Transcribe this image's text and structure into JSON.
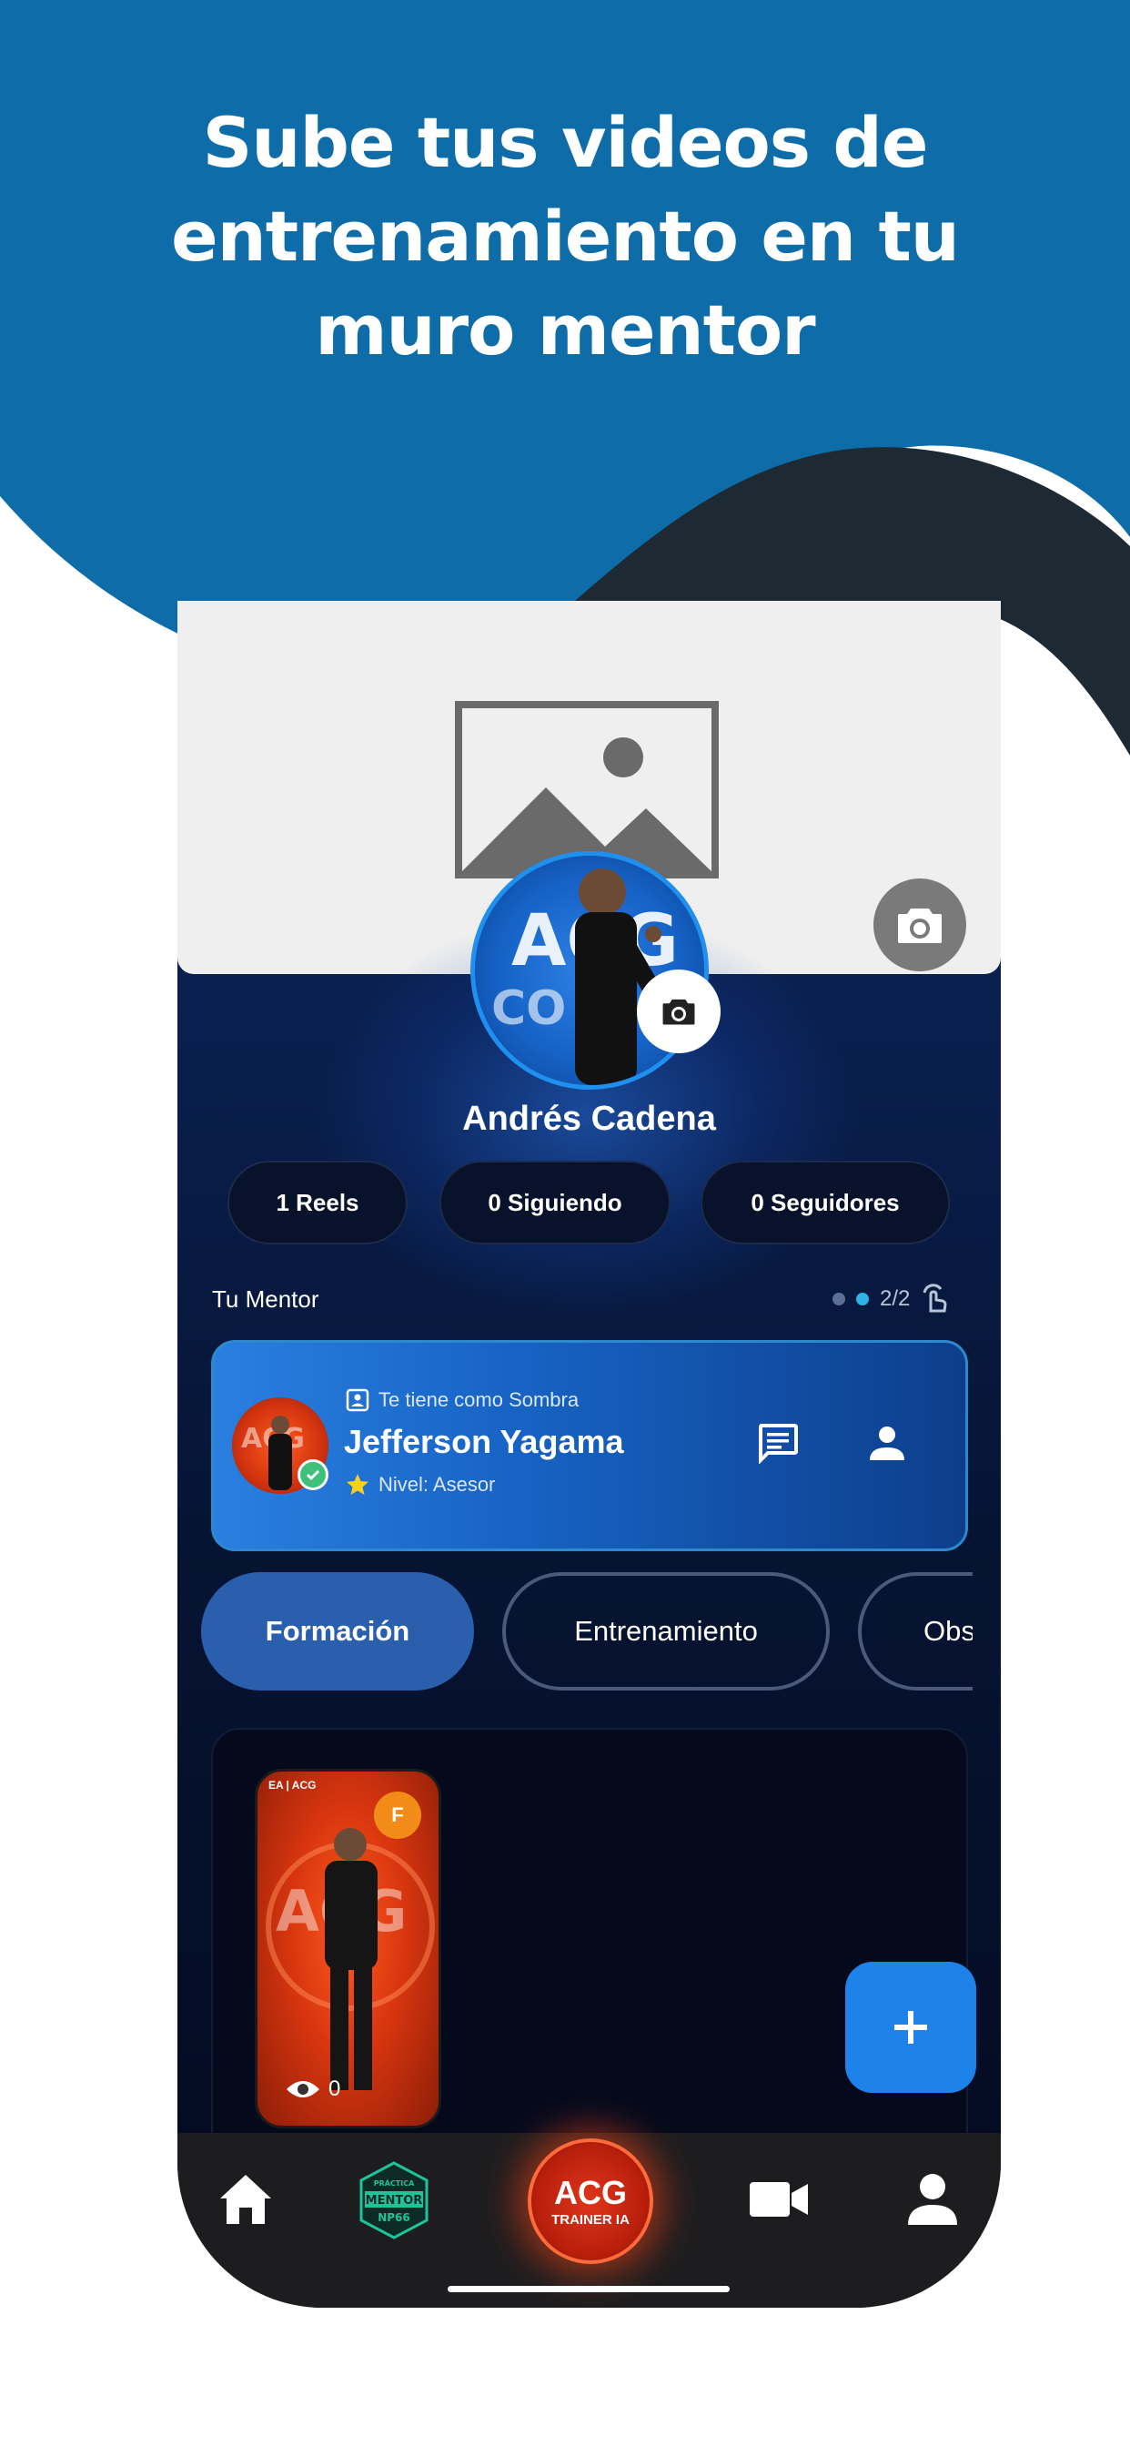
{
  "headline": "Sube tus videos de\nentrenamiento en tu\nmuro mentor",
  "profile": {
    "name": "Andrés Cadena",
    "avatar_text_1": "ACG",
    "avatar_text_2": "COACH"
  },
  "stats": [
    {
      "label": "1 Reels"
    },
    {
      "label": "0 Siguiendo"
    },
    {
      "label": "0 Seguidores"
    }
  ],
  "mentor_section": {
    "title": "Tu Mentor",
    "pager": "2/2"
  },
  "mentor_card": {
    "tag": "Te tiene como Sombra",
    "name": "Jefferson Yagama",
    "level": "Nivel: Asesor"
  },
  "tabs": [
    {
      "label": "Formación",
      "active": true
    },
    {
      "label": "Entrenamiento",
      "active": false
    },
    {
      "label": "Obs",
      "active": false
    }
  ],
  "reel": {
    "badge": "F",
    "brand": "EA | ACG",
    "views": "0"
  },
  "bottom_nav": {
    "mentor_badge_top": "PRÁCTICA",
    "mentor_badge_mid": "MENTOR",
    "mentor_badge_bottom": "NP66",
    "center_line1": "ACG",
    "center_line2": "TRAINER IA"
  },
  "colors": {
    "hero_blue": "#0e6ca8",
    "accent_blue": "#1d82ea",
    "active_tab": "#2a5fae",
    "center_red": "#d8301a",
    "mentor_badge_green": "#1fc39a"
  },
  "icons": [
    "image-placeholder-icon",
    "camera-icon",
    "id-card-icon",
    "star-icon",
    "chat-icon",
    "person-icon",
    "eye-icon",
    "plus-icon",
    "home-icon",
    "video-camera-icon",
    "swipe-hand-icon",
    "check-icon"
  ]
}
